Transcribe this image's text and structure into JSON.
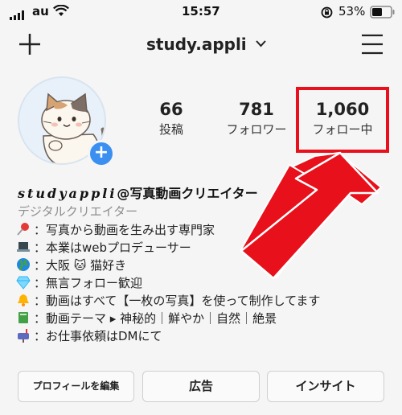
{
  "status_bar": {
    "carrier": "au",
    "time": "15:57",
    "battery": "53%"
  },
  "header": {
    "username": "study.appli",
    "plus_icon": "plus-icon",
    "menu_icon": "hamburger-menu-icon",
    "dropdown_icon": "chevron-down-icon"
  },
  "stats": {
    "posts_count": "66",
    "posts_label": "投稿",
    "followers_count": "781",
    "followers_label": "フォロワー",
    "following_count": "1,060",
    "following_label": "フォロー中"
  },
  "annotation": {
    "highlight_color": "#e8101b",
    "arrow_color": "#e8101b"
  },
  "bio": {
    "name_script": "studyappli",
    "name_suffix": "@写真動画クリエイター",
    "category": "デジタルクリエイター",
    "lines": [
      {
        "icon": "pushpin-icon",
        "text": "：写真から動画を生み出す専門家"
      },
      {
        "icon": "laptop-icon",
        "text": "：本業はwebプロデューサー"
      },
      {
        "icon": "globe-icon",
        "text": "：大阪 🐱 猫好き"
      },
      {
        "icon": "gem-icon",
        "text": "：無言フォロー歓迎"
      },
      {
        "icon": "bell-icon",
        "text": "：動画はすべて【一枚の写真】を使って制作してます"
      },
      {
        "icon": "book-icon",
        "text": "：動画テーマ ▸ 神秘的｜鮮やか｜自然｜絶景"
      },
      {
        "icon": "mailbox-icon",
        "text": "：お仕事依頼はDMにて"
      }
    ]
  },
  "buttons": {
    "edit_profile": "プロフィールを編集",
    "ads": "広告",
    "insights": "インサイト"
  }
}
